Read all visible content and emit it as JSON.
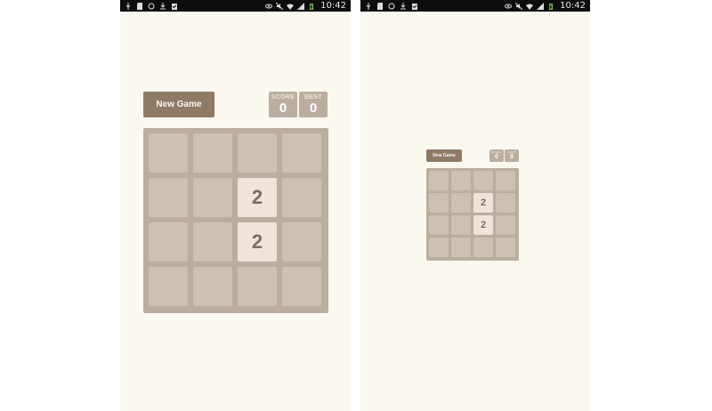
{
  "status_bar": {
    "time": "10:42",
    "left_icons": [
      "usb-icon",
      "sd-card-icon",
      "sync-icon",
      "download-icon",
      "clipboard-check-icon"
    ],
    "right_icons": [
      "eye-icon",
      "mute-icon",
      "wifi-icon",
      "signal-icon",
      "battery-charging-icon"
    ]
  },
  "game": {
    "new_game_label": "New Game",
    "score_label": "SCORE",
    "score_value": "0",
    "best_label": "BEST",
    "best_value": "0",
    "board": [
      [
        "",
        "",
        "",
        ""
      ],
      [
        "",
        "",
        "2",
        ""
      ],
      [
        "",
        "",
        "2",
        ""
      ],
      [
        "",
        "",
        "",
        ""
      ]
    ]
  },
  "colors": {
    "background": "#fbf8f0",
    "board": "#bbada0",
    "empty_cell": "#cdc1b4",
    "tile_2": "#eee4da",
    "tile_text": "#776e65",
    "button": "#8f7a66"
  }
}
